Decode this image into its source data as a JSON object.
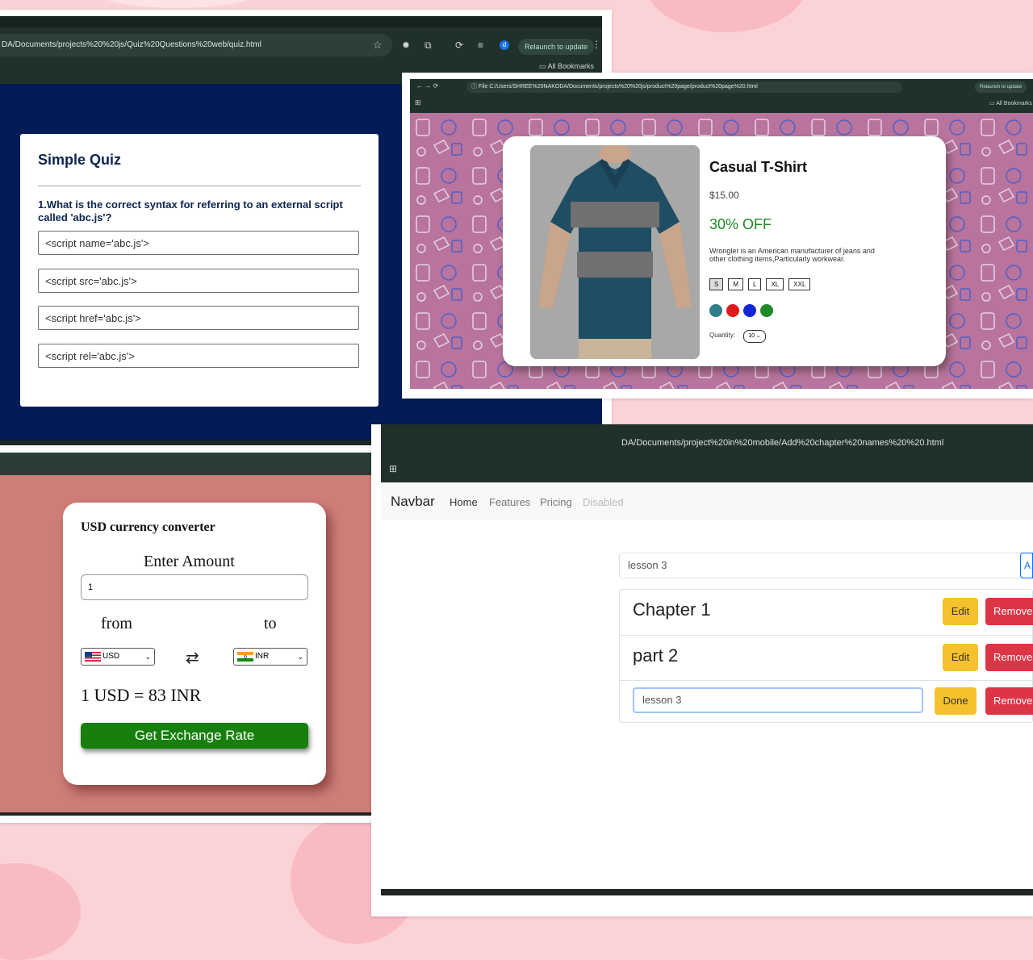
{
  "quiz": {
    "url": "DA/Documents/projects%20%20js/Quiz%20Questions%20web/quiz.html",
    "relaunch": "Relaunch to update",
    "bookmarks": "All Bookmarks",
    "avatar": "d",
    "title": "Simple Quiz",
    "question": "1.What is the correct syntax for referring to an external script called 'abc.js'?",
    "options": [
      "<script name='abc.js'>",
      "<script src='abc.js'>",
      "<script href='abc.js'>",
      "<script rel='abc.js'>"
    ]
  },
  "product": {
    "url": "C:/Users/SHREE%20NAKODA/Documents/projects%20%20js/product%20page/product%20page%20.html",
    "file_label": "File",
    "relaunch": "Relaunch to update",
    "bookmarks": "All Bookmarks",
    "name": "Casual T-Shirt",
    "price": "$15.00",
    "discount": "30% OFF",
    "description": "Wrongler is an American manufacturer of jeans and other clothing items,Particularly workwear.",
    "sizes": [
      "S",
      "M",
      "L",
      "XL",
      "XXL"
    ],
    "selected_size": "S",
    "colors": [
      "#2e7f87",
      "#e01b1b",
      "#1226d8",
      "#1f8a26"
    ],
    "quantity_label": "Quantity:",
    "quantity_value": "10"
  },
  "currency": {
    "title": "USD currency converter",
    "enter_amount_label": "Enter Amount",
    "amount_value": "1",
    "from_label": "from",
    "to_label": "to",
    "from_currency": "USD",
    "to_currency": "INR",
    "result": "1 USD = 83 INR",
    "button": "Get Exchange Rate"
  },
  "chapters": {
    "url": "DA/Documents/project%20in%20mobile/Add%20chapter%20names%20%20.html",
    "navbar": {
      "brand": "Navbar",
      "links": [
        "Home",
        "Features",
        "Pricing",
        "Disabled"
      ]
    },
    "input_value": "lesson 3",
    "add_button": "A",
    "items": [
      {
        "text": "Chapter 1",
        "action": "Edit",
        "remove": "Remove"
      },
      {
        "text": "part 2",
        "action": "Edit",
        "remove": "Remove"
      }
    ],
    "editing": {
      "value": "lesson 3",
      "action": "Done",
      "remove": "Remove"
    }
  }
}
